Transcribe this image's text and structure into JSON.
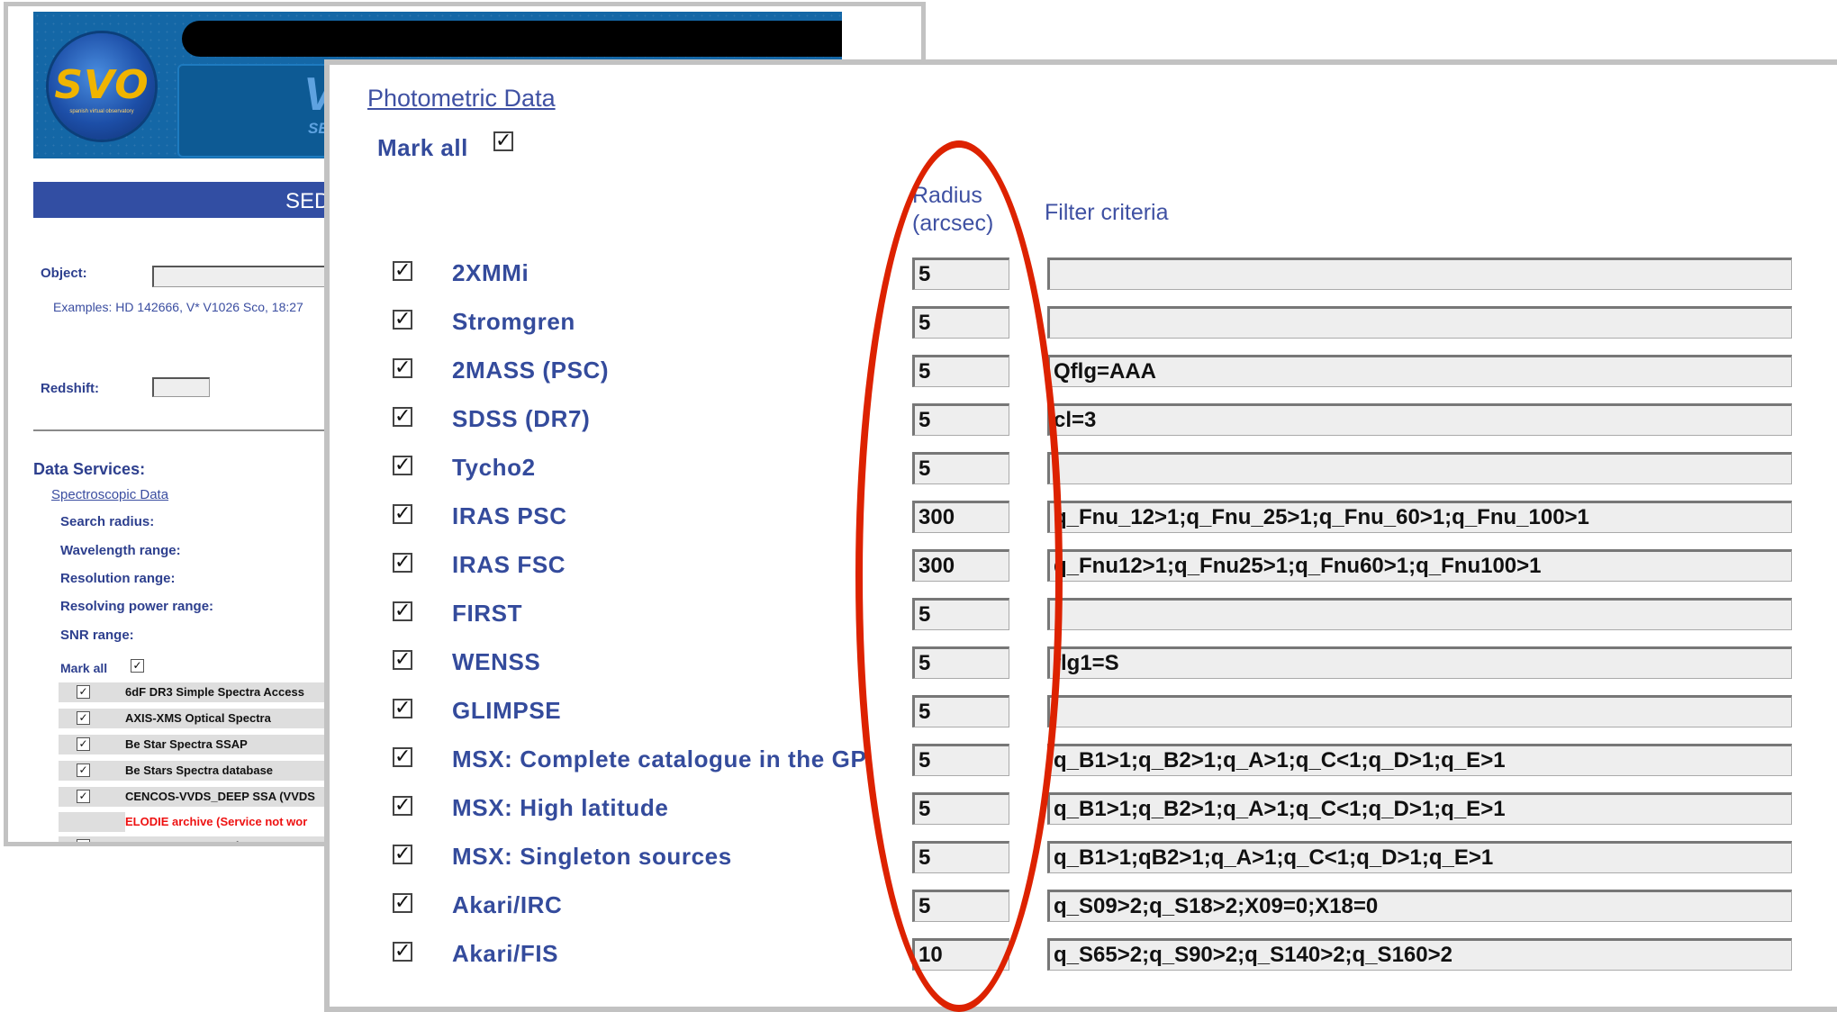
{
  "back_window": {
    "logo_text": "SVO",
    "logo_subtext": "spanish virtual observatory",
    "banner_letter": "V",
    "banner_sub": "SE",
    "sed_bar_text": "SED",
    "object_label": "Object:",
    "examples": "Examples: HD 142666, V* V1026 Sco, 18:27",
    "redshift_label": "Redshift:",
    "data_services": "Data Services:",
    "spectroscopic_link": "Spectroscopic Data",
    "params": [
      "Search radius:",
      "Wavelength range:",
      "Resolution range:",
      "Resolving power range:",
      "SNR range:"
    ],
    "mark_all": "Mark all",
    "services": [
      {
        "name": "6dF DR3 Simple Spectra Access",
        "checked": true,
        "unavailable": false
      },
      {
        "name": "AXIS-XMS Optical Spectra",
        "checked": true,
        "unavailable": false
      },
      {
        "name": "Be Star Spectra SSAP",
        "checked": true,
        "unavailable": false
      },
      {
        "name": "Be Stars Spectra database",
        "checked": true,
        "unavailable": false
      },
      {
        "name": "CENCOS-VVDS_DEEP SSA (VVDS",
        "checked": true,
        "unavailable": false
      },
      {
        "name": "ELODIE archive (Service not wor",
        "checked": false,
        "unavailable": true
      },
      {
        "name": "ESO Spectrum Service",
        "checked": true,
        "unavailable": false
      }
    ]
  },
  "front_window": {
    "title": "Photometric Data",
    "mark_all": "Mark all",
    "radius_header_line1": "Radius",
    "radius_header_line2": "(arcsec)",
    "filter_header": "Filter criteria",
    "rows": [
      {
        "name": "2XMMi",
        "radius": "5",
        "filter": ""
      },
      {
        "name": "Stromgren",
        "radius": "5",
        "filter": ""
      },
      {
        "name": "2MASS (PSC)",
        "radius": "5",
        "filter": "Qflg=AAA"
      },
      {
        "name": "SDSS (DR7)",
        "radius": "5",
        "filter": "cl=3"
      },
      {
        "name": "Tycho2",
        "radius": "5",
        "filter": ""
      },
      {
        "name": "IRAS PSC",
        "radius": "300",
        "filter": "q_Fnu_12>1;q_Fnu_25>1;q_Fnu_60>1;q_Fnu_100>1"
      },
      {
        "name": "IRAS FSC",
        "radius": "300",
        "filter": "q_Fnu12>1;q_Fnu25>1;q_Fnu60>1;q_Fnu100>1"
      },
      {
        "name": "FIRST",
        "radius": "5",
        "filter": ""
      },
      {
        "name": "WENSS",
        "radius": "5",
        "filter": "flg1=S"
      },
      {
        "name": "GLIMPSE",
        "radius": "5",
        "filter": ""
      },
      {
        "name": "MSX: Complete catalogue in the GP",
        "radius": "5",
        "filter": "q_B1>1;q_B2>1;q_A>1;q_C<1;q_D>1;q_E>1"
      },
      {
        "name": "MSX: High latitude",
        "radius": "5",
        "filter": "q_B1>1;q_B2>1;q_A>1;q_C<1;q_D>1;q_E>1"
      },
      {
        "name": "MSX: Singleton sources",
        "radius": "5",
        "filter": "q_B1>1;qB2>1;q_A>1;q_C<1;q_D>1;q_E>1"
      },
      {
        "name": "Akari/IRC",
        "radius": "5",
        "filter": "q_S09>2;q_S18>2;X09=0;X18=0"
      },
      {
        "name": "Akari/FIS",
        "radius": "10",
        "filter": "q_S65>2;q_S90>2;q_S140>2;q_S160>2"
      }
    ]
  },
  "colors": {
    "link": "#3f51a3",
    "highlight": "#dd2200",
    "banner": "#1467a6",
    "sed_bar": "#324ea3"
  }
}
